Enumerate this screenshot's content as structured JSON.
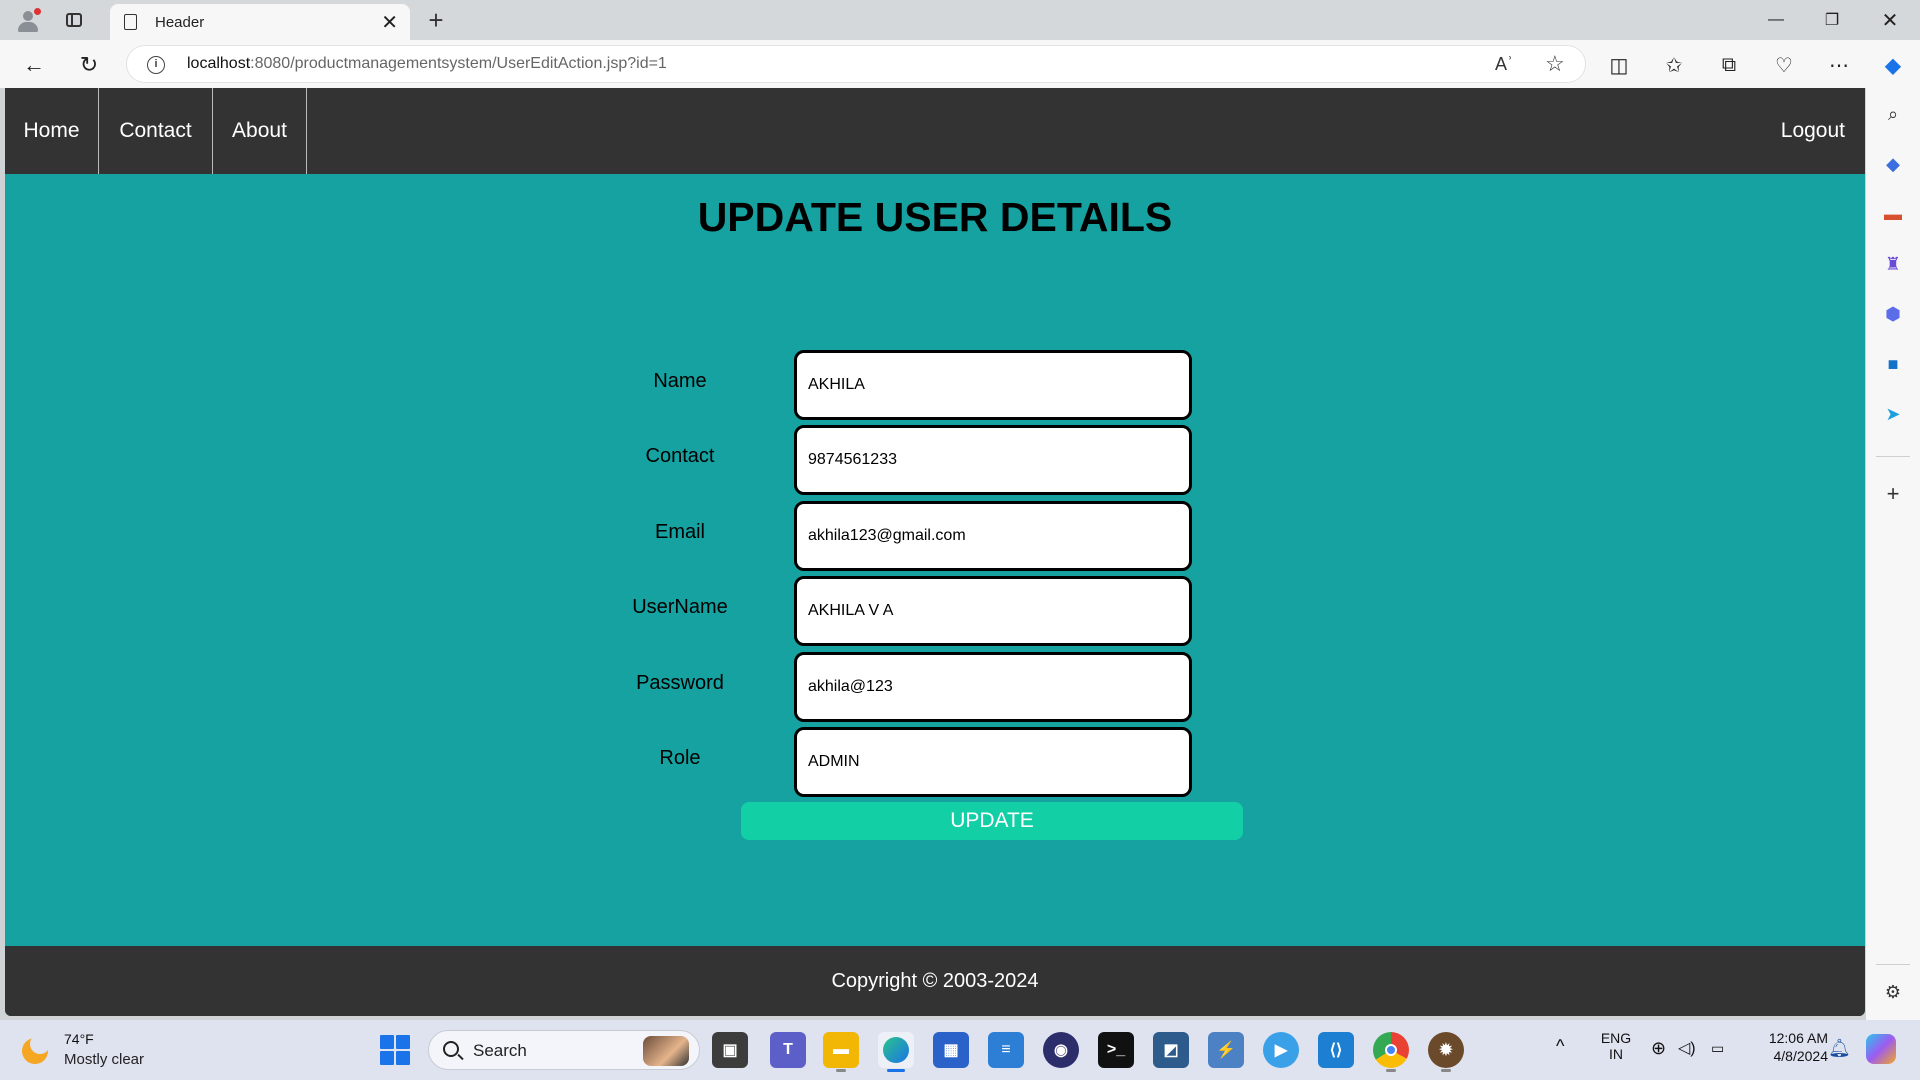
{
  "browser": {
    "tab_title": "Header",
    "url_host": "localhost",
    "url_rest": ":8080/productmanagementsystem/UserEditAction.jsp?id=1",
    "read_aloud_icon": "Aʾ"
  },
  "nav": {
    "home": "Home",
    "contact": "Contact",
    "about": "About",
    "logout": "Logout"
  },
  "page": {
    "heading": "UPDATE USER DETAILS",
    "fields": [
      {
        "label": "Name",
        "value": "AKHILA"
      },
      {
        "label": "Contact",
        "value": "9874561233"
      },
      {
        "label": "Email",
        "value": "akhila123@gmail.com"
      },
      {
        "label": "UserName",
        "value": "AKHILA V A"
      },
      {
        "label": "Password",
        "value": "akhila@123"
      },
      {
        "label": "Role",
        "value": "ADMIN"
      }
    ],
    "submit_label": "UPDATE",
    "footer": "Copyright © 2003-2024"
  },
  "taskbar": {
    "weather_temp": "74°F",
    "weather_cond": "Mostly clear",
    "search_label": "Search",
    "lang_top": "ENG",
    "lang_bottom": "IN",
    "time": "12:06 AM",
    "date": "4/8/2024"
  },
  "colors": {
    "page_bg": "#17a2a2",
    "nav_bg": "#333333",
    "button": "#12cfa5"
  }
}
